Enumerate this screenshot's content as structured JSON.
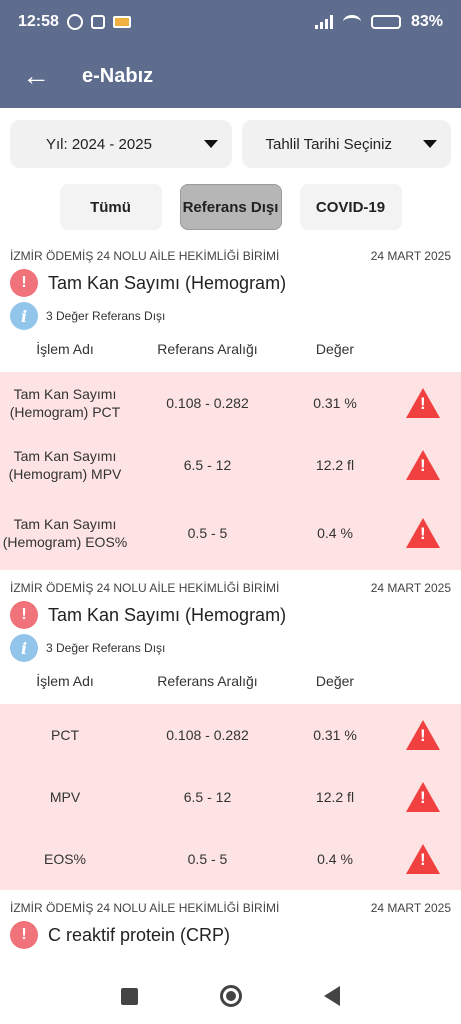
{
  "status_bar": {
    "time": "12:58",
    "battery": "83%",
    "battery_level": 0.83
  },
  "app_bar": {
    "title": "e-Nabız"
  },
  "filters": {
    "year": "Yıl: 2024 - 2025",
    "date": "Tahlil Tarihi Seçiniz"
  },
  "segments": {
    "all": "Tümü",
    "out_of_range": "Referans Dışı",
    "covid": "COVID-19",
    "active": "out_of_range"
  },
  "table_headers": {
    "name": "İşlem Adı",
    "range": "Referans Aralığı",
    "value": "Değer"
  },
  "results": [
    {
      "clinic": "İZMİR ÖDEMİŞ 24 NOLU AİLE HEKİMLİĞİ BİRİMİ",
      "date": "24 MART 2025",
      "title": "Tam Kan Sayımı (Hemogram)",
      "info": "3 Değer Referans Dışı",
      "rows": [
        {
          "name": "Tam Kan Sayımı (Hemogram) PCT",
          "range": "0.108 - 0.282",
          "value": "0.31  %"
        },
        {
          "name": "Tam Kan Sayımı (Hemogram) MPV",
          "range": "6.5 - 12",
          "value": "12.2  fl"
        },
        {
          "name": "Tam Kan Sayımı (Hemogram) EOS%",
          "range": "0.5 - 5",
          "value": "0.4  %"
        }
      ]
    },
    {
      "clinic": "İZMİR ÖDEMİŞ 24 NOLU AİLE HEKİMLİĞİ BİRİMİ",
      "date": "24 MART 2025",
      "title": "Tam Kan Sayımı (Hemogram)",
      "info": "3 Değer Referans Dışı",
      "rows": [
        {
          "name": "PCT",
          "range": "0.108 - 0.282",
          "value": "0.31 %"
        },
        {
          "name": "MPV",
          "range": "6.5 - 12",
          "value": "12.2 fl"
        },
        {
          "name": "EOS%",
          "range": "0.5 - 5",
          "value": "0.4 %"
        }
      ]
    },
    {
      "clinic": "İZMİR ÖDEMİŞ 24 NOLU AİLE HEKİMLİĞİ BİRİMİ",
      "date": "24 MART 2025",
      "title": "C reaktif protein (CRP)"
    }
  ],
  "icons": {
    "back": "arrow-left-icon",
    "warning": "warning-triangle-icon",
    "info": "info-icon"
  }
}
